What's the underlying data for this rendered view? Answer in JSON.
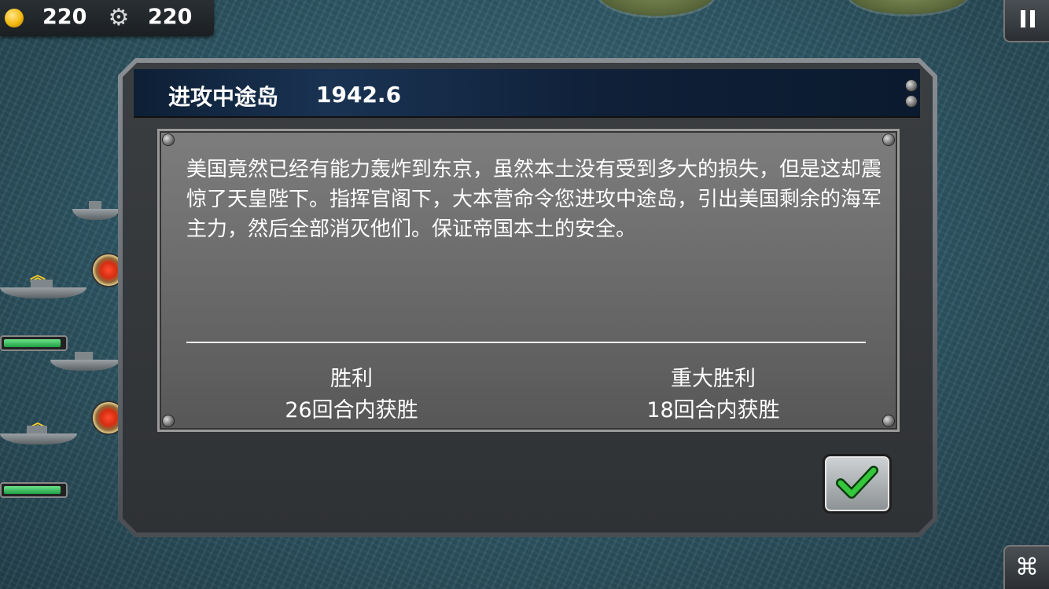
{
  "resources": {
    "coins": "220",
    "parts": "220"
  },
  "icons": {
    "coin": "coin-icon",
    "gear": "gear-icon",
    "pause": "pause-icon",
    "check": "check-icon",
    "corner": "network-icon"
  },
  "corner_button_glyph": "⌘",
  "dialog": {
    "title": "进攻中途岛",
    "date": "1942.6",
    "story": "美国竟然已经有能力轰炸到东京，虽然本土没有受到多大的损失，但是这却震惊了天皇陛下。指挥官阁下，大本营命令您进攻中途岛，引出美国剩余的海军主力，然后全部消灭他们。保证帝国本土的安全。",
    "victory": {
      "label": "胜利",
      "condition": "26回合内获胜"
    },
    "great_victory": {
      "label": "重大胜利",
      "condition": "18回合内获胜"
    }
  },
  "colors": {
    "title_bar": "#0f2038",
    "panel": "#6e6e6e",
    "check": "#35c63b",
    "hp_bar": "#1f9f45"
  }
}
